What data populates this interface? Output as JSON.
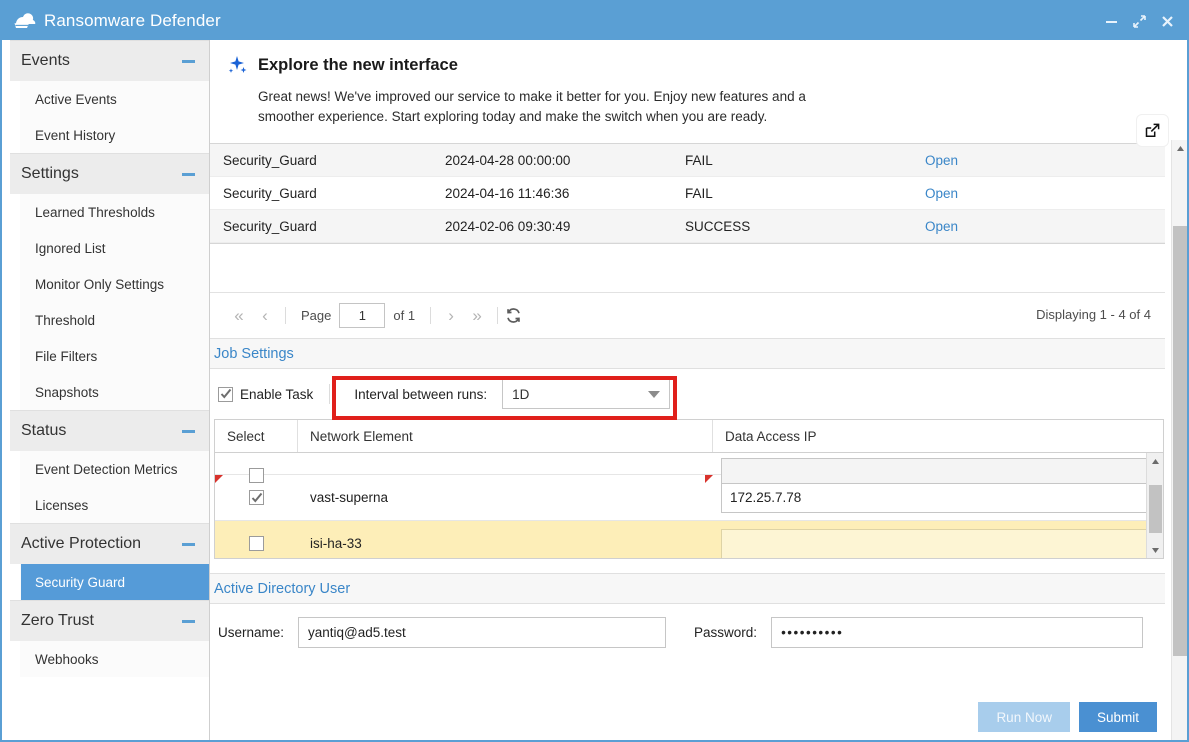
{
  "window": {
    "title": "Ransomware Defender",
    "logo_icon": "shield-cloud-icon",
    "controls": {
      "minimize": "minimize-icon",
      "maximize": "maximize-icon",
      "close": "close-icon"
    }
  },
  "sidebar": {
    "groups": [
      {
        "label": "Events",
        "collapse_icon": "collapse-minus-icon",
        "items": [
          {
            "label": "Active Events",
            "selected": false
          },
          {
            "label": "Event History",
            "selected": false
          }
        ]
      },
      {
        "label": "Settings",
        "collapse_icon": "collapse-minus-icon",
        "items": [
          {
            "label": "Learned Thresholds",
            "selected": false
          },
          {
            "label": "Ignored List",
            "selected": false
          },
          {
            "label": "Monitor Only Settings",
            "selected": false
          },
          {
            "label": "Threshold",
            "selected": false
          },
          {
            "label": "File Filters",
            "selected": false
          },
          {
            "label": "Snapshots",
            "selected": false
          }
        ]
      },
      {
        "label": "Status",
        "collapse_icon": "collapse-minus-icon",
        "items": [
          {
            "label": "Event Detection Metrics",
            "selected": false
          },
          {
            "label": "Licenses",
            "selected": false
          }
        ]
      },
      {
        "label": "Active Protection",
        "collapse_icon": "collapse-minus-icon",
        "items": [
          {
            "label": "Security Guard",
            "selected": true
          }
        ]
      },
      {
        "label": "Zero Trust",
        "collapse_icon": "collapse-minus-icon",
        "items": [
          {
            "label": "Webhooks",
            "selected": false
          }
        ]
      }
    ]
  },
  "banner": {
    "icon": "sparkle-icon",
    "title": "Explore the new interface",
    "body": "Great news! We've improved our service to make it better for you. Enjoy new features and a smoother experience. Start exploring today and make the switch when you are ready.",
    "action_icon": "external-link-icon"
  },
  "events_table": {
    "rows": [
      {
        "name": "Security_Guard",
        "timestamp": "2024-04-28 00:00:00",
        "status": "FAIL",
        "action": "Open"
      },
      {
        "name": "Security_Guard",
        "timestamp": "2024-04-16 11:46:36",
        "status": "FAIL",
        "action": "Open"
      },
      {
        "name": "Security_Guard",
        "timestamp": "2024-02-06 09:30:49",
        "status": "SUCCESS",
        "action": "Open"
      }
    ]
  },
  "pager": {
    "first_icon": "first-page-icon",
    "prev_icon": "previous-page-icon",
    "page_label": "Page",
    "page_value": "1",
    "of_label": "of 1",
    "next_icon": "next-page-icon",
    "last_icon": "last-page-icon",
    "refresh_icon": "refresh-icon",
    "displaying": "Displaying 1 - 4 of 4"
  },
  "job_settings": {
    "section_title": "Job Settings",
    "enable_task_label": "Enable Task",
    "enable_task_checked": true,
    "interval_label": "Interval between runs:",
    "interval_value": "1D",
    "interval_arrow_icon": "chevron-down-icon",
    "highlight_color": "#e0201b"
  },
  "network_grid": {
    "columns": [
      "Select",
      "Network Element",
      "Data Access IP"
    ],
    "rows": [
      {
        "name": "",
        "ip": "",
        "checked": false,
        "highlighted": false,
        "clipped": true,
        "dirty": false
      },
      {
        "name": "vast-superna",
        "ip": "172.25.7.78",
        "checked": true,
        "highlighted": false,
        "clipped": false,
        "dirty": true
      },
      {
        "name": "isi-ha-33",
        "ip": "",
        "checked": false,
        "highlighted": true,
        "clipped": false,
        "dirty": false
      }
    ],
    "scroll_up_icon": "scroll-up-icon",
    "scroll_down_icon": "scroll-down-icon"
  },
  "ad_user": {
    "section_title": "Active Directory User",
    "username_label": "Username:",
    "username_value": "yantiq@ad5.test",
    "password_label": "Password:",
    "password_value": "••••••••••"
  },
  "footer": {
    "run_now_label": "Run Now",
    "run_now_disabled": true,
    "submit_label": "Submit"
  },
  "colors": {
    "titlebar": "#5a9fd4",
    "accent_link": "#3a86c8",
    "selected_nav": "#559bd8",
    "highlight_row": "#fdeeb8",
    "primary_button": "#4a90d2",
    "disabled_button": "#a8cdec"
  }
}
